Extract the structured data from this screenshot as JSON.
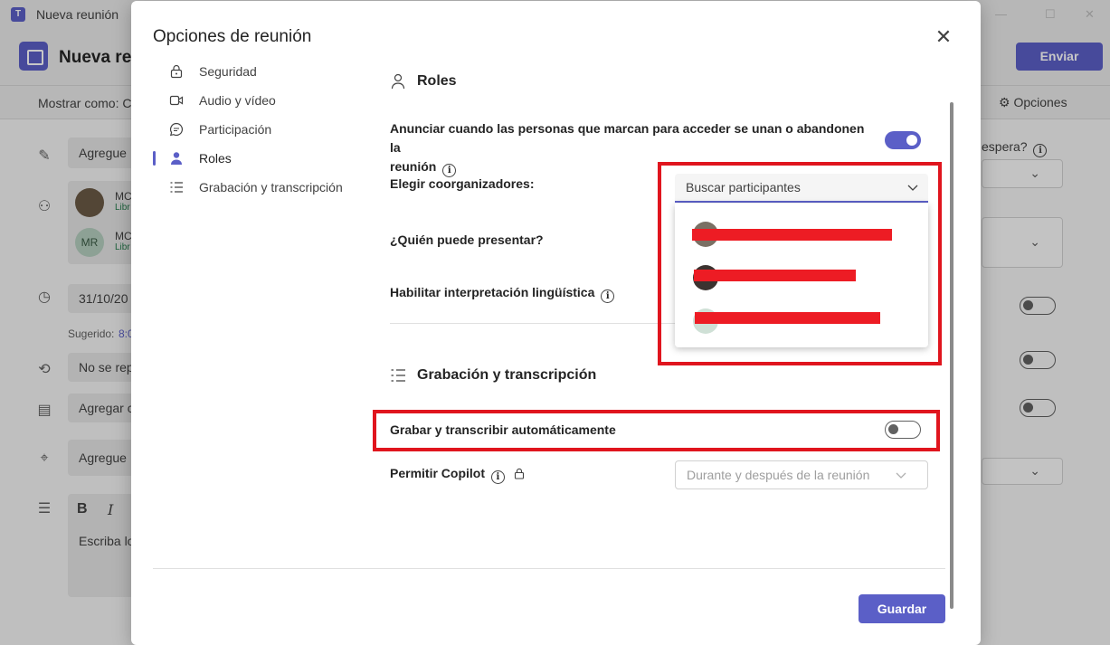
{
  "window": {
    "title": "Nueva reunión",
    "logo": "T"
  },
  "header": {
    "title": "Nueva reun",
    "send_label": "Enviar"
  },
  "subbar": {
    "show_as": "Mostrar como: C",
    "options_label": "Opciones"
  },
  "form": {
    "title_placeholder": "Agregue",
    "attendees": [
      {
        "initials": "",
        "name": "MC",
        "status": "Libr"
      },
      {
        "initials": "MR",
        "name": "MC",
        "status": "Libr"
      }
    ],
    "date": "31/10/20",
    "suggested_label": "Sugerido:",
    "suggested_value": "8:0",
    "repeat": "No se rep",
    "channel": "Agregar c",
    "location": "Agregue",
    "bold": "B",
    "italic": "I",
    "body_placeholder": "Escriba lo",
    "right_lobby_text": "espera?"
  },
  "dialog": {
    "title": "Opciones de reunión",
    "nav": [
      {
        "label": "Seguridad",
        "icon": "lock-icon"
      },
      {
        "label": "Audio y vídeo",
        "icon": "video-icon"
      },
      {
        "label": "Participación",
        "icon": "chat-icon"
      },
      {
        "label": "Roles",
        "icon": "person-icon"
      },
      {
        "label": "Grabación y transcripción",
        "icon": "list-icon"
      }
    ],
    "active_nav": "Roles",
    "roles": {
      "title": "Roles",
      "announce_label": "Anunciar cuando las personas que marcan para acceder se unan o abandonen la",
      "announce_label_2": "reunión",
      "announce_on": true,
      "coorganizers_label": "Elegir coorganizadores:",
      "search_placeholder": "Buscar participantes",
      "presenter_label": "¿Quién puede presentar?",
      "interpretation_label": "Habilitar interpretación lingüística"
    },
    "recording": {
      "title": "Grabación y transcripción",
      "auto_label": "Grabar y transcribir automáticamente",
      "auto_on": false,
      "copilot_label": "Permitir Copilot",
      "copilot_value": "Durante y después de la reunión"
    },
    "save_label": "Guardar"
  },
  "colors": {
    "accent": "#5b5fc7",
    "highlight": "#e0151e",
    "redaction": "#ed1c24"
  }
}
